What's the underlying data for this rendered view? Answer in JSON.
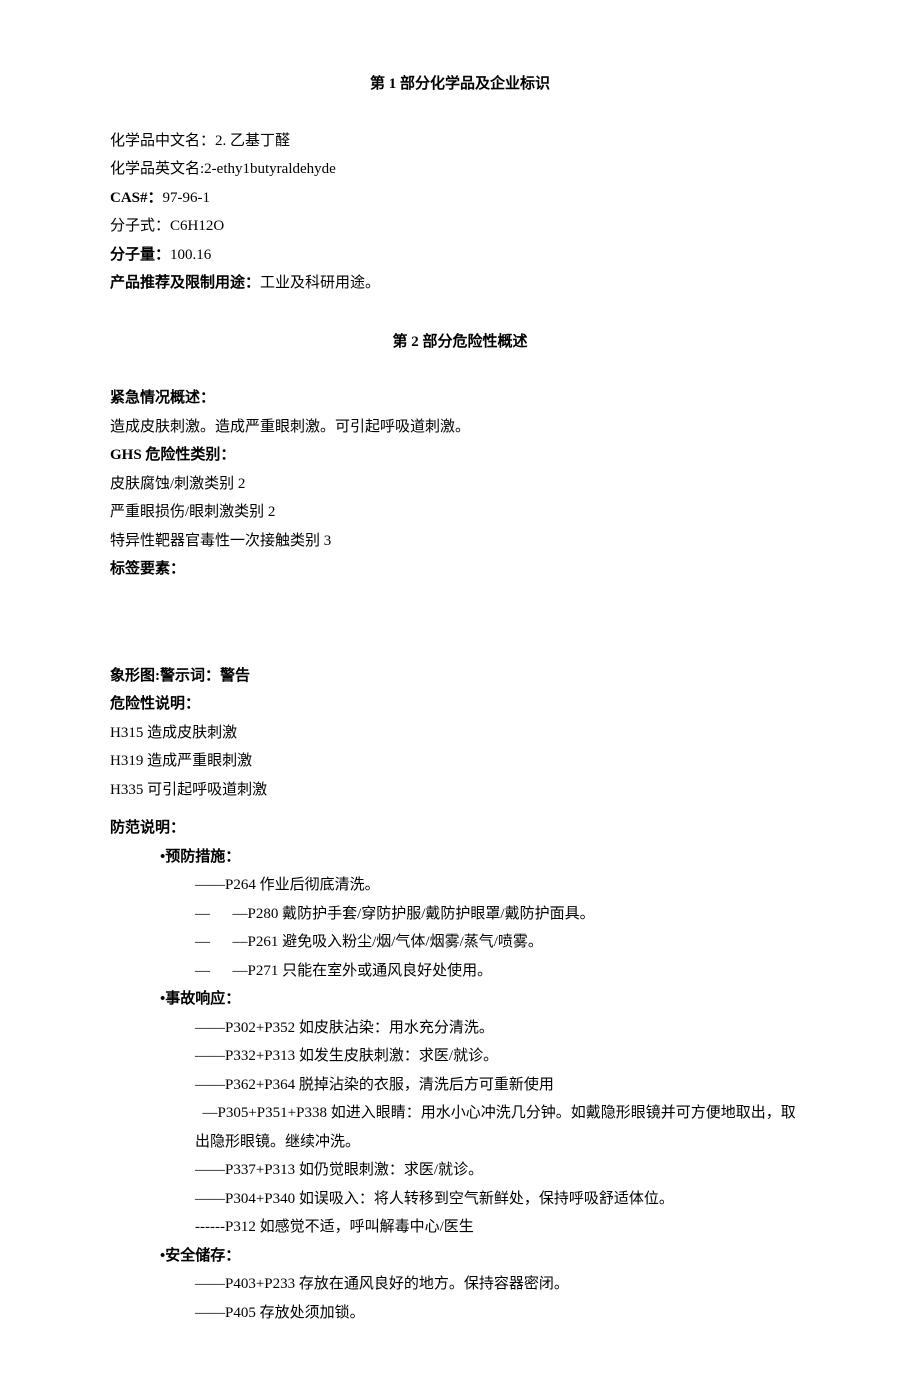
{
  "section1": {
    "title": "第 1 部分化学品及企业标识",
    "fields": {
      "chineseNameLabel": "化学品中文名：",
      "chineseNameValue": "2. 乙基丁醛",
      "englishNameLabel": "化学品英文名:",
      "englishNameValue": "2-ethy1butyraldehyde",
      "casLabel": "CAS#：",
      "casValue": "97-96-1",
      "formulaLabel": "分子式：",
      "formulaValue": "C6H12O",
      "mwLabel": "分子量：",
      "mwValue": "100.16",
      "useLabel": "产品推荐及限制用途：",
      "useValue": "工业及科研用途。"
    }
  },
  "section2": {
    "title": "第 2 部分危险性概述",
    "emergency": {
      "label": "紧急情况概述：",
      "text": "造成皮肤刺激。造成严重眼刺激。可引起呼吸道刺激。"
    },
    "ghs": {
      "label": "GHS 危险性类别：",
      "items": [
        "皮肤腐蚀/刺激类别 2",
        "严重眼损伤/眼刺激类别 2",
        "特异性靶器官毒性一次接触类别 3"
      ]
    },
    "labelElementsLabel": "标签要素：",
    "pictogram": "象形图:警示词：警告",
    "hazard": {
      "label": "危险性说明：",
      "items": [
        "H315 造成皮肤刺激",
        "H319 造成严重眼刺激",
        "H335 可引起呼吸道刺激"
      ]
    },
    "precaution": {
      "label": "防范说明：",
      "prevention": {
        "label": "•预防措施：",
        "items": [
          "——P264 作业后彻底清洗。",
          "—      —P280 戴防护手套/穿防护服/戴防护眼罩/戴防护面具。",
          "—      —P261 避免吸入粉尘/烟/气体/烟雾/蒸气/喷雾。",
          "—      —P271 只能在室外或通风良好处使用。"
        ]
      },
      "response": {
        "label": "•事故响应：",
        "items": [
          "——P302+P352 如皮肤沾染：用水充分清洗。",
          "——P332+P313 如发生皮肤刺激：求医/就诊。",
          "——P362+P364 脱掉沾染的衣服，清洗后方可重新使用",
          "  —P305+P351+P338 如进入眼睛：用水小心冲洗几分钟。如戴隐形眼镜并可方便地取出，取出隐形眼镜。继续冲洗。",
          "——P337+P313 如仍觉眼刺激：求医/就诊。",
          "——P304+P340 如误吸入：将人转移到空气新鲜处，保持呼吸舒适体位。",
          "------P312 如感觉不适，呼叫解毒中心/医生"
        ]
      },
      "storage": {
        "label": "•安全储存：",
        "items": [
          "——P403+P233 存放在通风良好的地方。保持容器密闭。",
          "——P405 存放处须加锁。"
        ]
      }
    }
  }
}
